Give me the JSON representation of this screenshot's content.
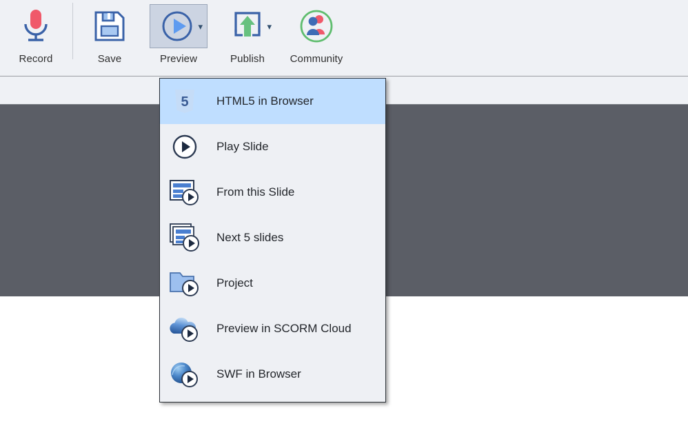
{
  "toolbar": {
    "items": [
      {
        "label": "Record",
        "icon": "microphone-icon",
        "has_caret": false,
        "active": false
      },
      {
        "label": "Save",
        "icon": "floppy-disk-icon",
        "has_caret": false,
        "active": false
      },
      {
        "label": "Preview",
        "icon": "play-circle-icon",
        "has_caret": true,
        "active": true
      },
      {
        "label": "Publish",
        "icon": "publish-upload-icon",
        "has_caret": true,
        "active": false
      },
      {
        "label": "Community",
        "icon": "community-people-icon",
        "has_caret": false,
        "active": false
      }
    ]
  },
  "preview_menu": {
    "items": [
      {
        "label": "HTML5 in Browser",
        "icon": "html5-shield-icon",
        "highlighted": true
      },
      {
        "label": "Play Slide",
        "icon": "play-circle-icon",
        "highlighted": false
      },
      {
        "label": "From this Slide",
        "icon": "slide-play-icon",
        "highlighted": false
      },
      {
        "label": "Next 5 slides",
        "icon": "slides-stack-play-icon",
        "highlighted": false
      },
      {
        "label": "Project",
        "icon": "folder-play-icon",
        "highlighted": false
      },
      {
        "label": "Preview in SCORM Cloud",
        "icon": "cloud-play-icon",
        "highlighted": false
      },
      {
        "label": "SWF in Browser",
        "icon": "flash-sphere-play-icon",
        "highlighted": false
      }
    ]
  },
  "colors": {
    "ribbon_bg": "#eff1f5",
    "workspace_bg": "#5b5e66",
    "menu_bg": "#eef0f4",
    "menu_highlight": "#bfdeff",
    "accent_blue": "#3a62a8",
    "record_red": "#f0596a",
    "publish_green": "#67c17f",
    "community_green": "#5fbd6e"
  }
}
